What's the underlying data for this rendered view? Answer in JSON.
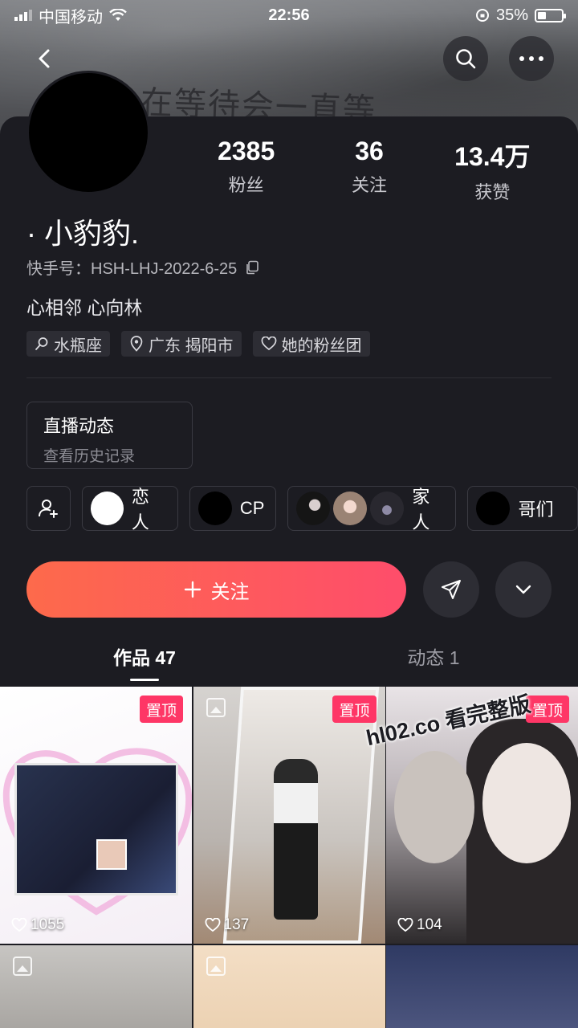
{
  "status_bar": {
    "carrier": "中国移动",
    "time": "22:56",
    "battery": "35%"
  },
  "banner": {
    "text": "在等待会一直等"
  },
  "profile": {
    "nickname": "· 小豹豹.",
    "kuaishou_id": "快手号：HSH-LHJ-2022-6-25",
    "bio": "心相邻 心向林",
    "stats": [
      {
        "value": "2385",
        "label": "粉丝"
      },
      {
        "value": "36",
        "label": "关注"
      },
      {
        "value": "13.4万",
        "label": "获赞"
      }
    ],
    "tags": [
      {
        "icon": "search-icon",
        "label": "水瓶座"
      },
      {
        "icon": "location-icon",
        "label": "广东 揭阳市"
      },
      {
        "icon": "heart-icon",
        "label": "她的粉丝团"
      }
    ]
  },
  "live": {
    "title": "直播动态",
    "subtitle": "查看历史记录"
  },
  "relations": [
    {
      "label": "恋人"
    },
    {
      "label": "CP"
    },
    {
      "label": "家人"
    },
    {
      "label": "哥们"
    }
  ],
  "actions": {
    "follow": "关注"
  },
  "tabs": [
    {
      "label": "作品 47",
      "active": true
    },
    {
      "label": "动态 1",
      "active": false
    }
  ],
  "posts": [
    {
      "pinned": true,
      "pin_label": "置顶",
      "likes": "1055"
    },
    {
      "pinned": true,
      "pin_label": "置顶",
      "likes": "137"
    },
    {
      "pinned": true,
      "pin_label": "置顶",
      "likes": "104"
    }
  ],
  "watermark": "hl02.co 看完整版",
  "colors": {
    "accent_start": "#fd6a4b",
    "accent_end": "#fe4d6b",
    "pin": "#fe3666",
    "background": "#1c1c22"
  }
}
